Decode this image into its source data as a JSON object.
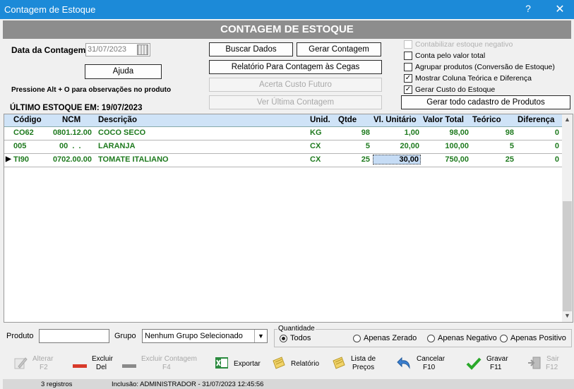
{
  "window": {
    "title": "Contagem de Estoque",
    "help": "?",
    "close": "✕"
  },
  "header": {
    "title": "CONTAGEM DE ESTOQUE"
  },
  "form": {
    "date_label": "Data da Contagem:",
    "date_value": "31/07/2023",
    "help_button": "Ajuda",
    "hint": "Pressione Alt + O para observações no produto",
    "last_stock": "ÚLTIMO ESTOQUE EM: 19/07/2023"
  },
  "buttons": {
    "buscar": "Buscar Dados",
    "gerar": "Gerar Contagem",
    "relatorio_cegas": "Relatório Para Contagem às Cegas",
    "acerta_custo": "Acerta Custo Futuro",
    "ver_ultima": "Ver Última Contagem",
    "gerar_cadastro": "Gerar todo cadastro de Produtos"
  },
  "options": [
    {
      "label": "Contabilizar estoque negativo",
      "checked": false,
      "disabled": true
    },
    {
      "label": "Conta pelo valor total",
      "checked": false,
      "disabled": false
    },
    {
      "label": "Agrupar produtos (Conversão de Estoque)",
      "checked": false,
      "disabled": false
    },
    {
      "label": "Mostrar Coluna Teórica e Diferença",
      "checked": true,
      "disabled": false
    },
    {
      "label": "Gerar Custo do Estoque",
      "checked": true,
      "disabled": false
    }
  ],
  "table": {
    "columns": [
      "Código",
      "NCM",
      "Descrição",
      "Unid.",
      "Qtde",
      "Vl. Unitário",
      "Valor Total",
      "Teórico",
      "Diferença"
    ],
    "rows": [
      [
        "CO62",
        "0801.12.00",
        "COCO SECO",
        "KG",
        "98",
        "1,00",
        "98,00",
        "98",
        "0"
      ],
      [
        "005",
        "00  .  .",
        "LARANJA",
        "CX",
        "5",
        "20,00",
        "100,00",
        "5",
        "0"
      ],
      [
        "TI90",
        "0702.00.00",
        "TOMATE ITALIANO",
        "CX",
        "25",
        "30,00",
        "750,00",
        "25",
        "0"
      ]
    ],
    "current_row_marker": "▶"
  },
  "filter": {
    "produto_label": "Produto",
    "grupo_label": "Grupo",
    "grupo_value": "Nenhum Grupo Selecionado",
    "quantidade_label": "Quantidade",
    "radios": [
      {
        "label": "Todos",
        "selected": true
      },
      {
        "label": "Apenas Zerado",
        "selected": false
      },
      {
        "label": "Apenas Negativo",
        "selected": false
      },
      {
        "label": "Apenas Positivo",
        "selected": false
      }
    ]
  },
  "toolbar": {
    "alterar": [
      "Alterar",
      "F2"
    ],
    "excluir": [
      "Excluir",
      "Del"
    ],
    "excluir_contagem": [
      "Excluir Contagem",
      "F4"
    ],
    "exportar": "Exportar",
    "relatorio": "Relatório",
    "lista": [
      "Lista de",
      "Preços"
    ],
    "cancelar": [
      "Cancelar",
      "F10"
    ],
    "gravar": [
      "Gravar",
      "F11"
    ],
    "sair": [
      "Sair",
      "F12"
    ]
  },
  "status": {
    "records": "3 registros",
    "inclusion": "Inclusão: ADMINISTRADOR - 31/07/2023 12:45:56"
  },
  "colors": {
    "titlebar": "#1c8ad8",
    "row_text": "#1e7a1e",
    "header_band": "#8d8d8d"
  }
}
